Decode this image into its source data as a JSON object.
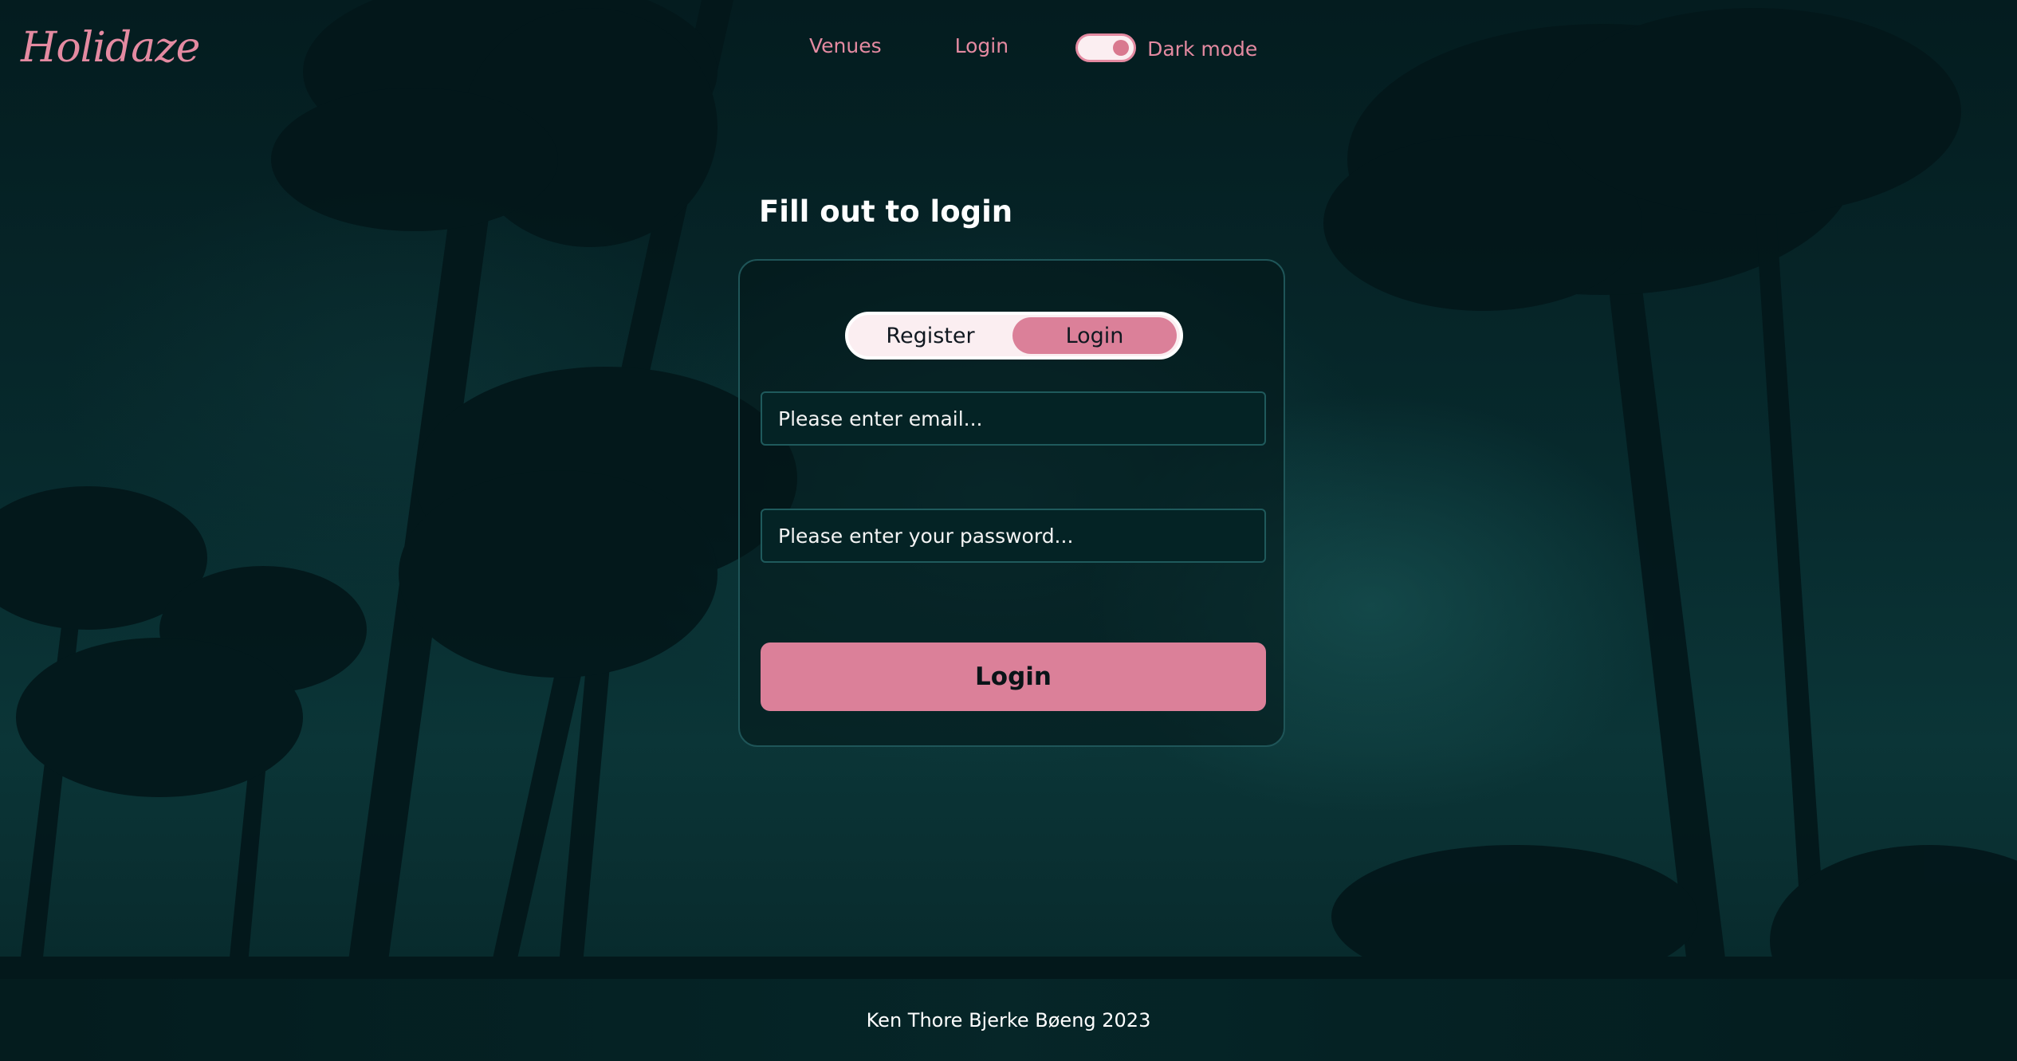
{
  "brand": {
    "logo_text": "Holidaze",
    "accent_color": "#db8099"
  },
  "nav": {
    "links": [
      {
        "label": "Venues"
      },
      {
        "label": "Login"
      }
    ],
    "dark_mode": {
      "label": "Dark mode",
      "enabled": true
    }
  },
  "form": {
    "title": "Fill out to login",
    "tabs": [
      {
        "label": "Register",
        "active": false
      },
      {
        "label": "Login",
        "active": true
      }
    ],
    "email_placeholder": "Please enter email...",
    "password_placeholder": "Please enter your password...",
    "submit_label": "Login"
  },
  "footer": {
    "text": "Ken Thore Bjerke Bøeng 2023"
  }
}
